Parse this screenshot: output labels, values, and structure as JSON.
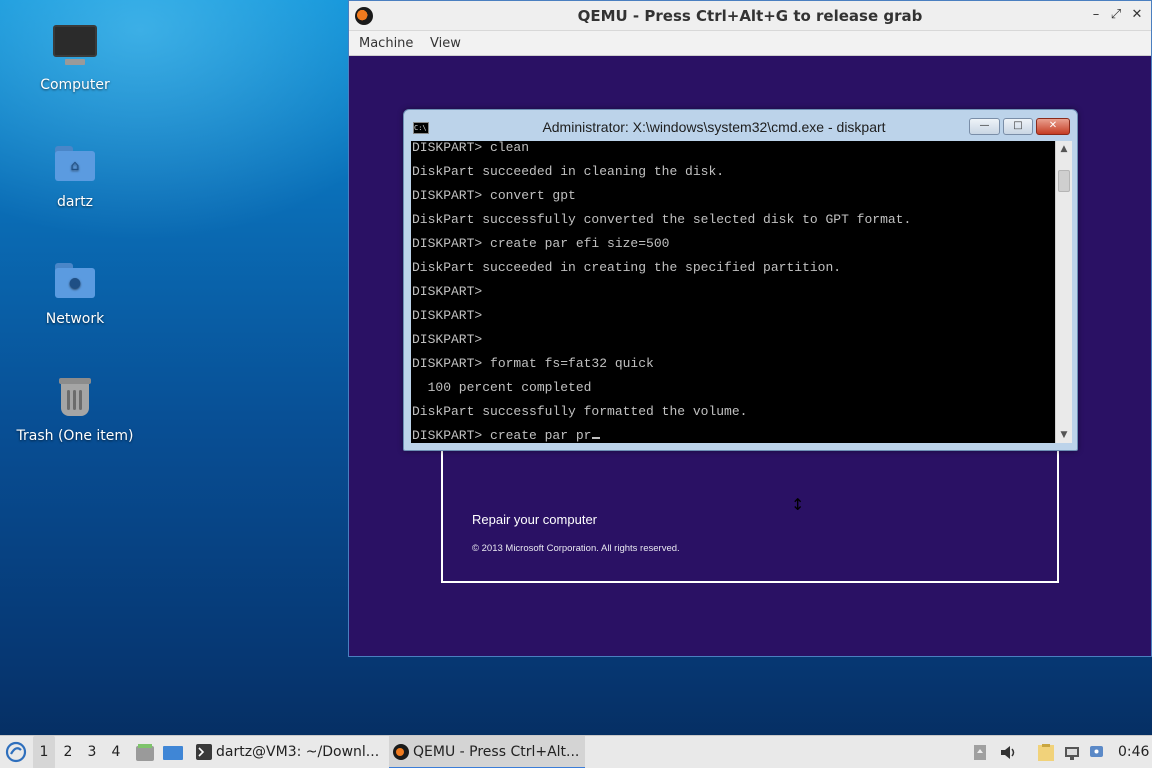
{
  "desktop": {
    "icons": [
      {
        "label": "Computer",
        "icon": "computer-icon"
      },
      {
        "label": "dartz",
        "icon": "home-folder-icon"
      },
      {
        "label": "Network",
        "icon": "network-folder-icon"
      },
      {
        "label": "Trash (One item)",
        "icon": "trash-icon"
      }
    ]
  },
  "qemu": {
    "title": "QEMU - Press Ctrl+Alt+G to release grab",
    "controls": {
      "minimize": "–",
      "maximize": "⤢",
      "close": "✕"
    },
    "menu": [
      "Machine",
      "View"
    ]
  },
  "setup": {
    "repair_link": "Repair your computer",
    "copyright": "© 2013 Microsoft Corporation. All rights reserved."
  },
  "cmd": {
    "title": "Administrator: X:\\windows\\system32\\cmd.exe - diskpart",
    "icon_text": "C:\\",
    "controls": {
      "minimize": "—",
      "maximize": "□",
      "close": "✕"
    },
    "lines": [
      "DISKPART> clean",
      "DiskPart succeeded in cleaning the disk.",
      "DISKPART> convert gpt",
      "DiskPart successfully converted the selected disk to GPT format.",
      "DISKPART> create par efi size=500",
      "DiskPart succeeded in creating the specified partition.",
      "DISKPART>",
      "DISKPART>",
      "DISKPART>",
      "DISKPART> format fs=fat32 quick",
      "  100 percent completed",
      "DiskPart successfully formatted the volume.",
      "DISKPART> create par pr"
    ],
    "scroll_up": "▲",
    "scroll_down": "▼"
  },
  "taskbar": {
    "start_icon": "start-menu-icon",
    "workspaces": [
      "1",
      "2",
      "3",
      "4"
    ],
    "active_workspace": "1",
    "tasks": [
      {
        "label": "dartz@VM3: ~/Downl...",
        "icon": "terminal-icon"
      },
      {
        "label": "QEMU - Press Ctrl+Alt...",
        "icon": "qemu-icon"
      }
    ],
    "clock": "0:46"
  }
}
